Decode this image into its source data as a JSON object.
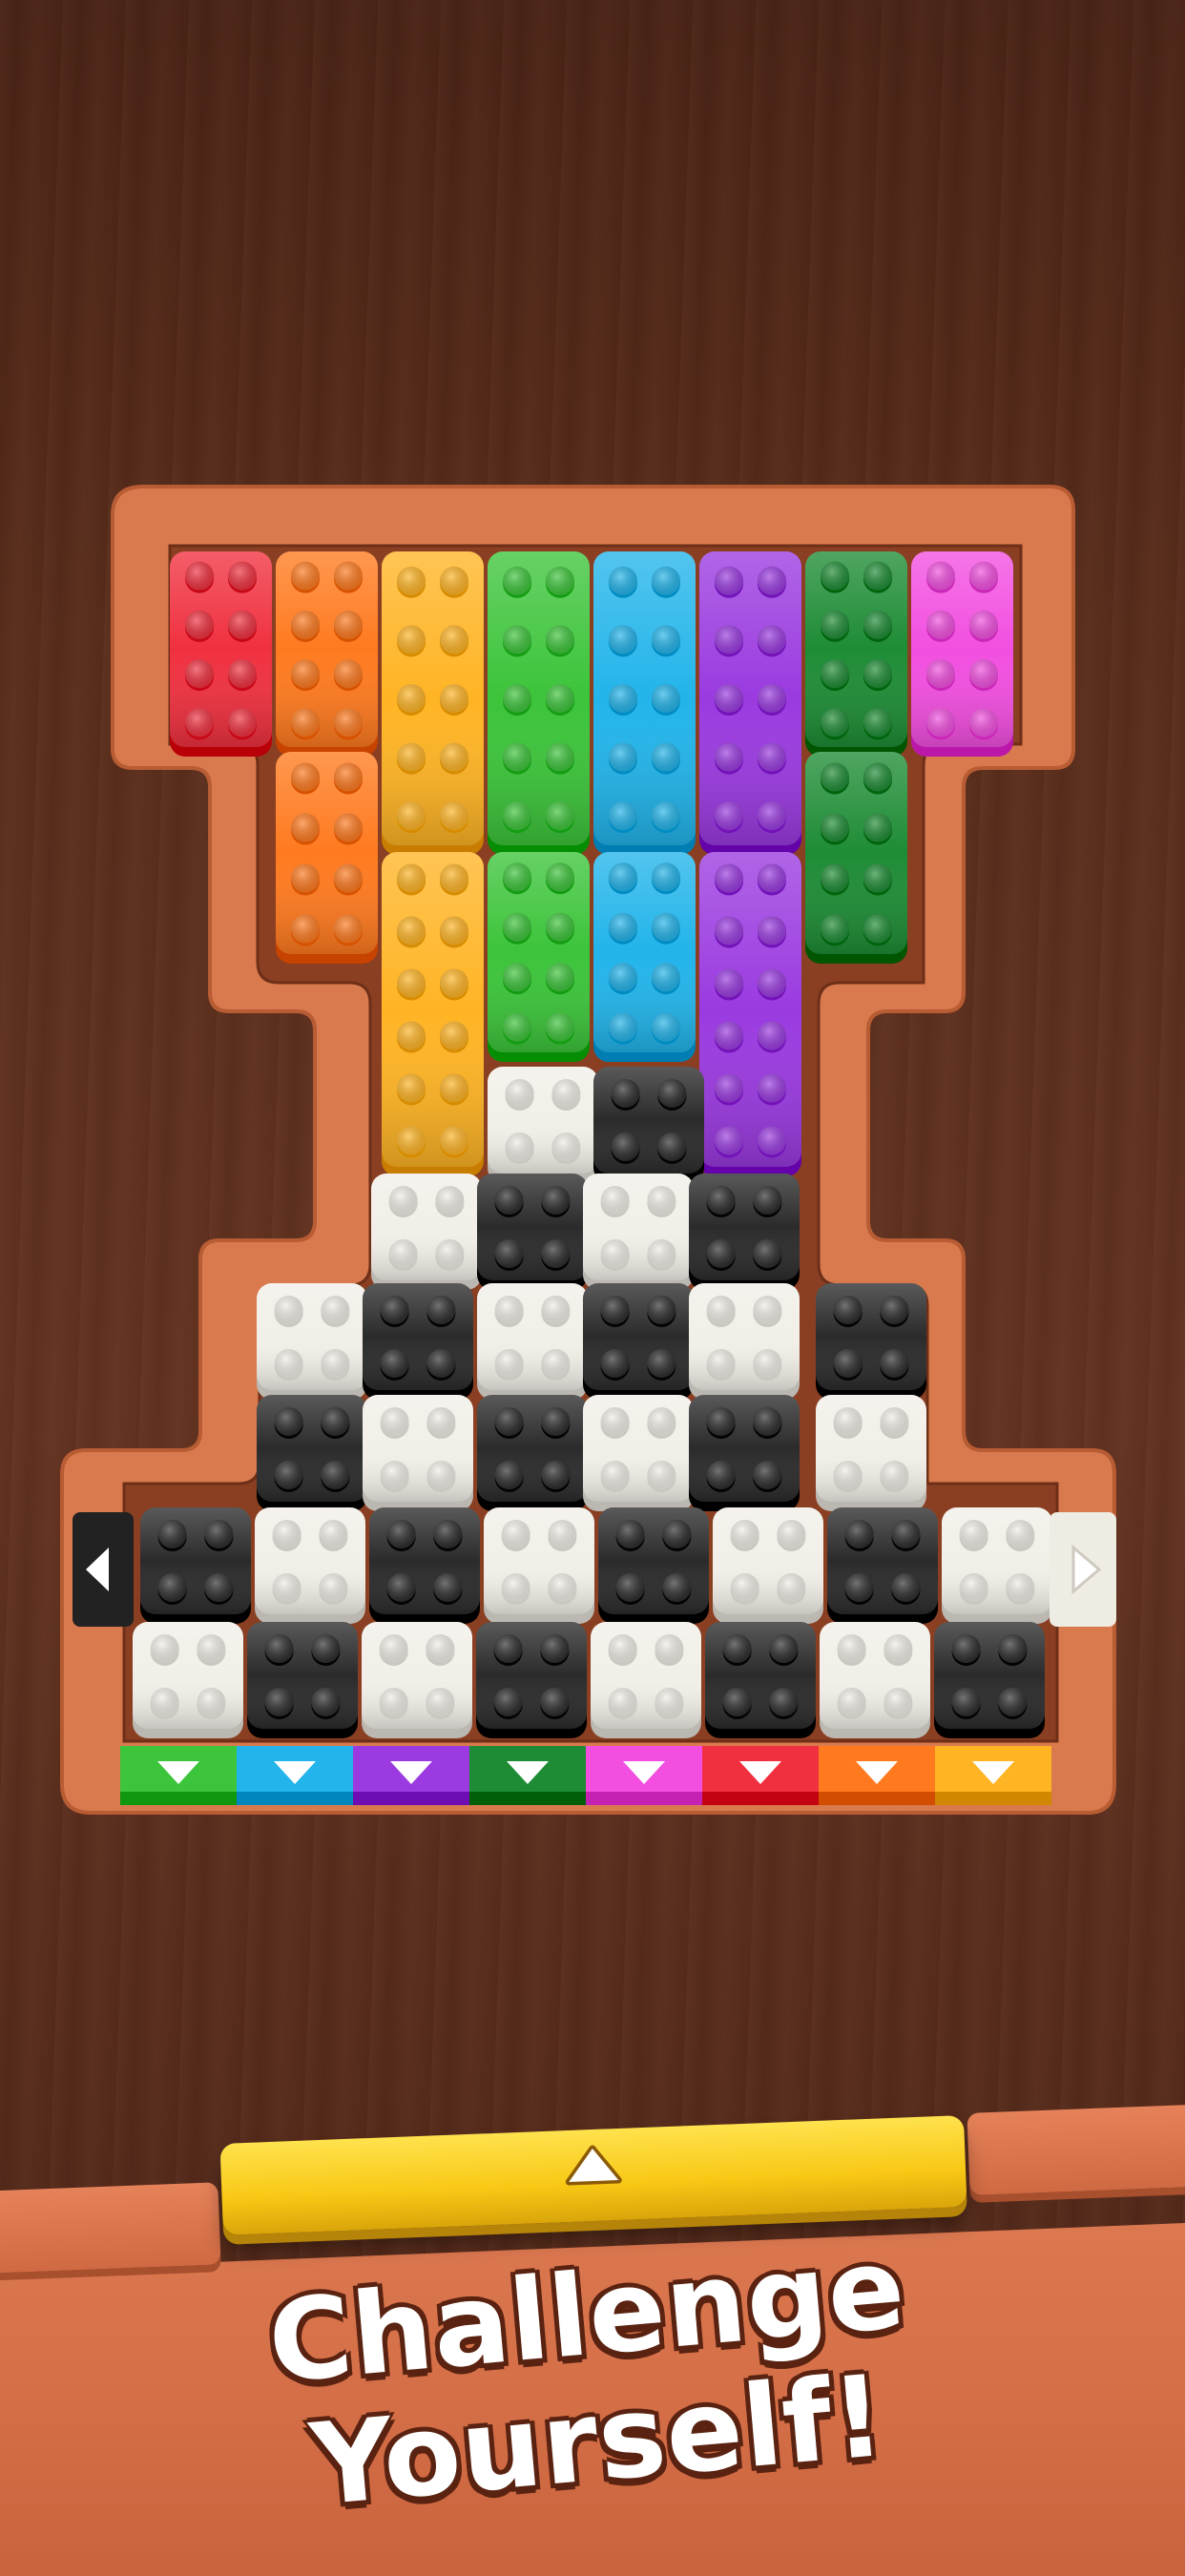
{
  "board": {
    "top_columns": [
      {
        "color": "#f0303f"
      },
      {
        "color": "#ff7a1f"
      },
      {
        "color": "#ffb424"
      },
      {
        "color": "#3cc43a"
      },
      {
        "color": "#22b4ea"
      },
      {
        "color": "#9a3ae0"
      },
      {
        "color": "#1e8c35"
      },
      {
        "color": "#f24fe0"
      }
    ],
    "checker_colors": {
      "white": "#f2efe8",
      "black": "#2b2b2b"
    },
    "side_arrows": {
      "left": "left-arrow-icon",
      "right": "right-arrow-icon"
    },
    "exit_gates": [
      {
        "color": "#3cc43a",
        "icon": "down-arrow-icon"
      },
      {
        "color": "#22b4ea",
        "icon": "down-arrow-icon"
      },
      {
        "color": "#9a3ae0",
        "icon": "down-arrow-icon"
      },
      {
        "color": "#1e8c35",
        "icon": "down-arrow-icon"
      },
      {
        "color": "#f24fe0",
        "icon": "down-arrow-icon"
      },
      {
        "color": "#f0303f",
        "icon": "down-arrow-icon"
      },
      {
        "color": "#ff7a1f",
        "icon": "down-arrow-icon"
      },
      {
        "color": "#ffb424",
        "icon": "down-arrow-icon"
      }
    ],
    "frame_color": "#d97a4e"
  },
  "launcher": {
    "icon": "up-arrow-icon",
    "color": "#f8c815"
  },
  "tagline": {
    "line1": "Challenge",
    "line2": "Yourself!"
  }
}
